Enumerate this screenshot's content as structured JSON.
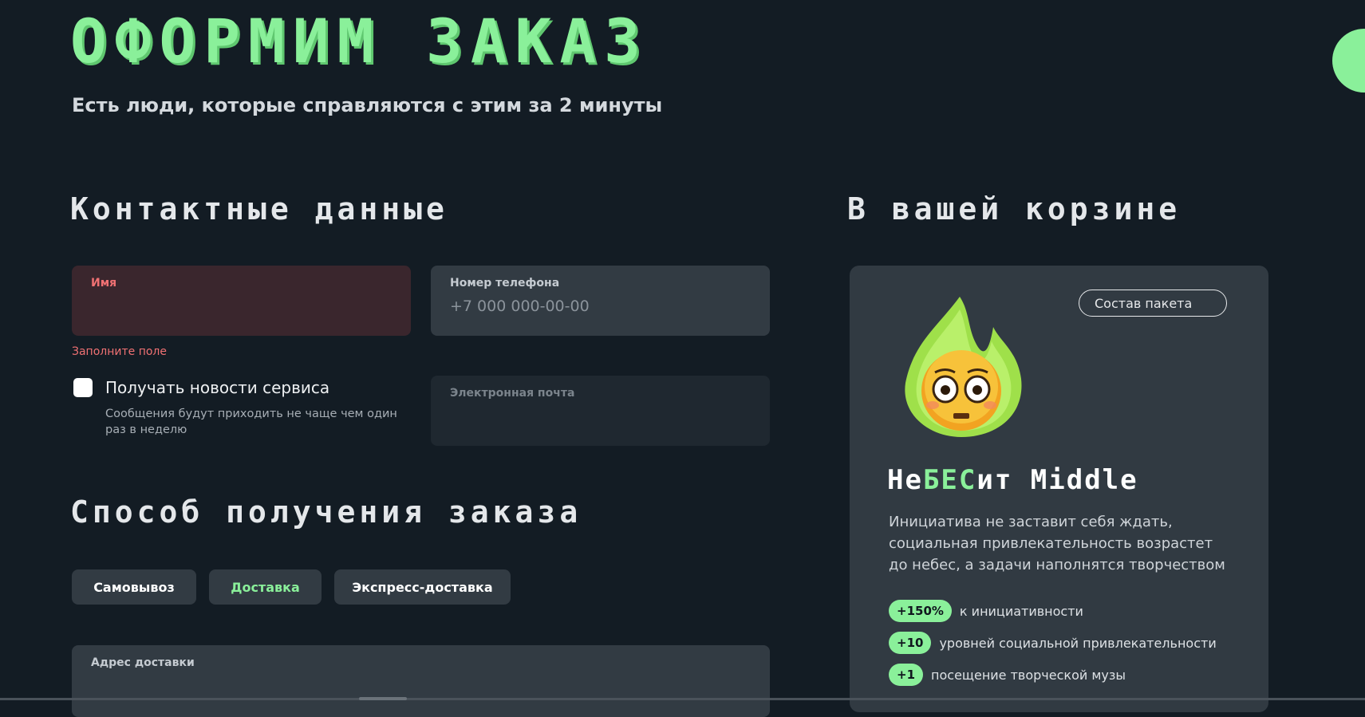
{
  "page": {
    "title": "ОФОРМИМ ЗАКАЗ",
    "subtitle": "Есть люди, которые справляются с этим за 2 минуты"
  },
  "contacts": {
    "section_title": "Контактные данные",
    "name_label": "Имя",
    "name_value": "",
    "name_error": "Заполните поле",
    "phone_label": "Номер телефона",
    "phone_placeholder": "+7 000 000-00-00",
    "email_label": "Электронная почта",
    "email_value": "",
    "news_checkbox_label": "Получать новости сервиса",
    "news_checkbox_checked": false,
    "news_hint": "Сообщения будут приходить не чаще чем один раз в неделю"
  },
  "delivery": {
    "section_title": "Способ получения заказа",
    "options": [
      "Самовывоз",
      "Доставка",
      "Экспресс-доставка"
    ],
    "selected": "Доставка",
    "address_label": "Адрес доставки"
  },
  "cart": {
    "section_title": "В вашей корзине",
    "composition_button": "Состав пакета",
    "product_name_pre": "Не",
    "product_name_hl": "БЕС",
    "product_name_post": "ит Middle",
    "product_icon": "flame-emoji-icon",
    "product_description": "Инициатива не заставит себя ждать, социальная привлекательность возрастет до небес, а задачи наполнятся творчеством",
    "perks": [
      {
        "badge": "+150%",
        "text": "к инициативности"
      },
      {
        "badge": "+10",
        "text": "уровней социальной привлекательности"
      },
      {
        "badge": "+1",
        "text": "посещение творческой музы"
      }
    ]
  },
  "colors": {
    "accent": "#8af09a",
    "background": "#131c24",
    "card": "#313a42",
    "error": "#f07173"
  }
}
